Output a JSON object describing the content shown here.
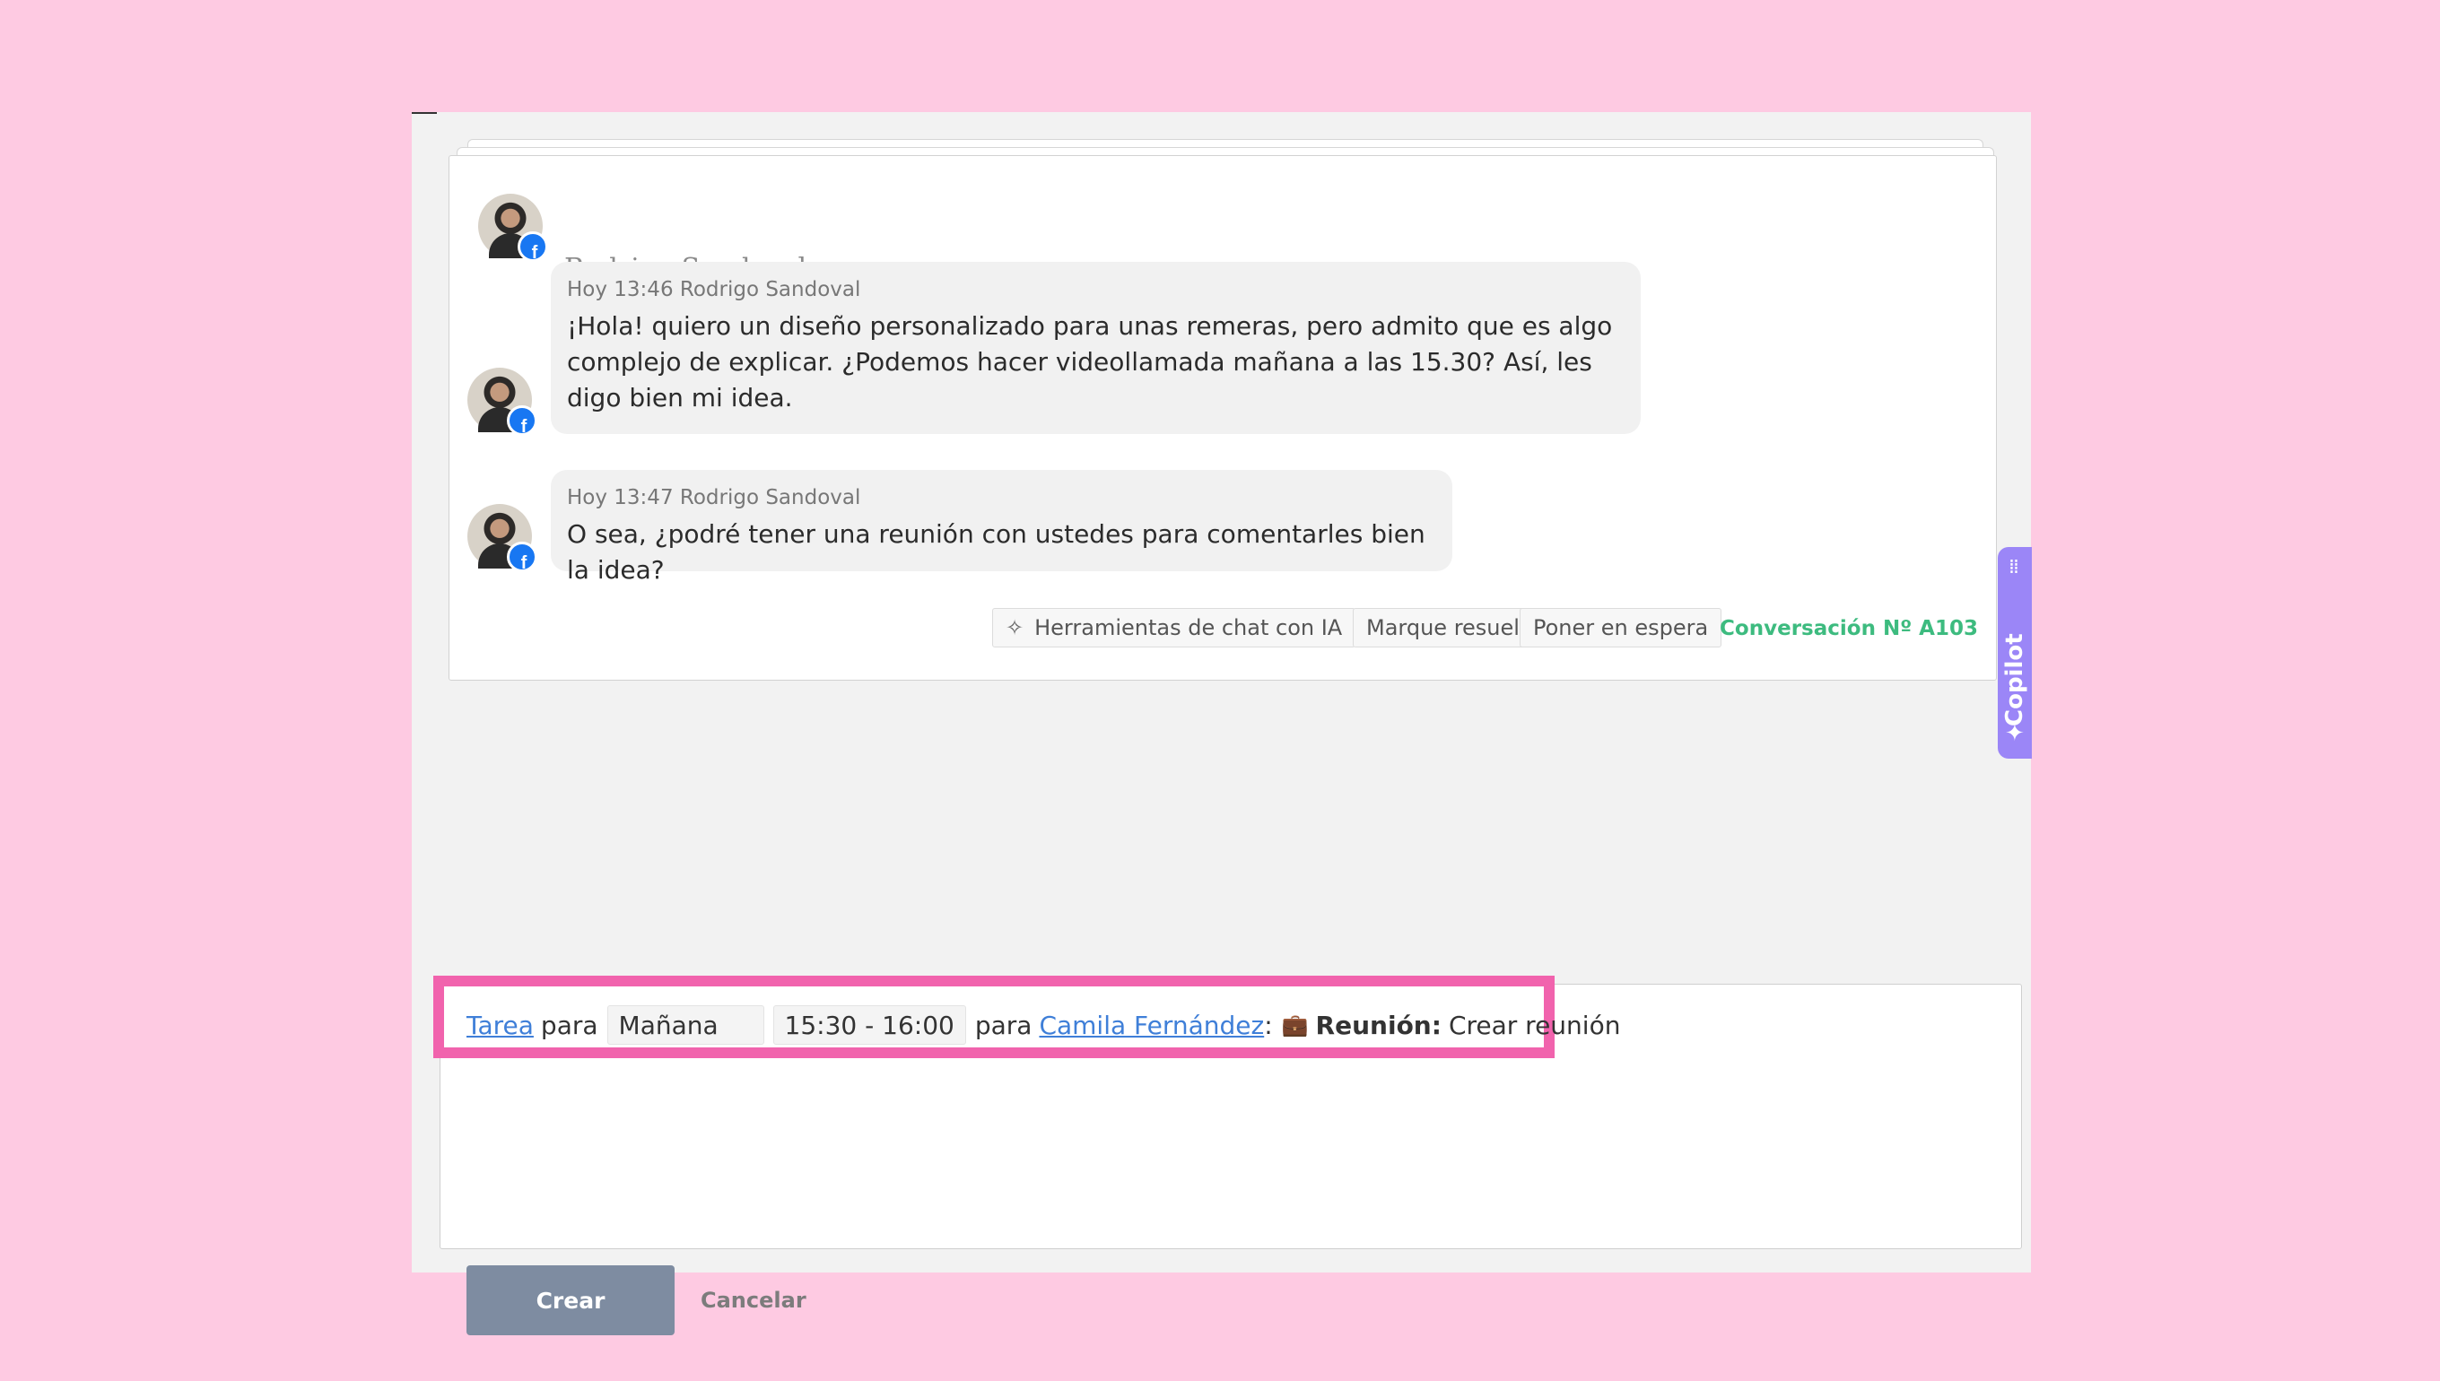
{
  "chat": {
    "sender_name": "Rodrigo Sandoval",
    "messages": [
      {
        "meta": "Hoy 13:46 Rodrigo Sandoval",
        "text": "¡Hola! quiero un diseño personalizado para unas remeras, pero admito que es algo complejo de explicar. ¿Podemos hacer videollamada mañana a las 15.30? Así, les digo bien mi idea."
      },
      {
        "meta": "Hoy 13:47 Rodrigo Sandoval",
        "text": "O sea, ¿podré tener una reunión con ustedes para comentarles bien la idea?"
      }
    ],
    "actions": {
      "ai_tools": "Herramientas de chat con IA",
      "mark_resolved": "Marque resuelto",
      "hold": "Poner en espera"
    },
    "conversation_id": "Conversación Nº A103"
  },
  "copilot": {
    "label": "Copilot"
  },
  "task": {
    "type_link": "Tarea",
    "para1": "para",
    "date_value": "Mañana",
    "time_value": "15:30 - 16:00",
    "para2": "para",
    "assignee": "Camila Fernández",
    "colon": ":",
    "kind_label": "Reunión:",
    "title": "Crear reunión"
  },
  "buttons": {
    "create": "Crear",
    "cancel": "Cancelar"
  },
  "colors": {
    "background": "#fecae2",
    "highlight": "#f163ad",
    "conversation_id": "#3dbb7f",
    "copilot": "#9b86f7",
    "create_button": "#7e8ca1",
    "link": "#3f7fd8"
  },
  "icons": {
    "facebook_badge": "facebook-icon",
    "sparkle": "sparkle-icon",
    "briefcase": "briefcase-icon"
  }
}
